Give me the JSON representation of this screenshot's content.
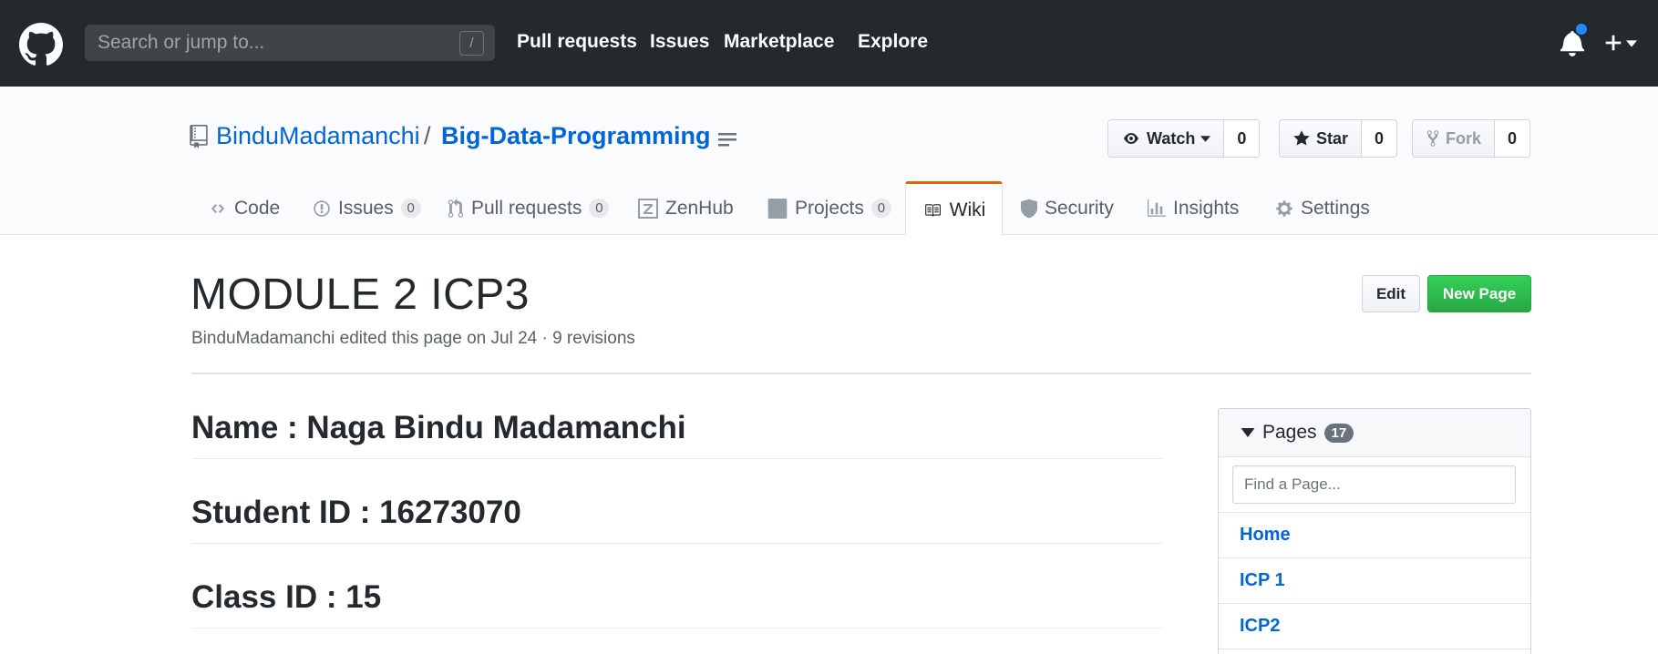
{
  "header": {
    "search_placeholder": "Search or jump to...",
    "search_shortcut": "/",
    "nav": [
      "Pull requests",
      "Issues",
      "Marketplace",
      "Explore"
    ]
  },
  "repo": {
    "owner": "BinduMadamanchi",
    "separator": "/",
    "name": "Big-Data-Programming",
    "watch": {
      "label": "Watch",
      "count": "0"
    },
    "star": {
      "label": "Star",
      "count": "0"
    },
    "fork": {
      "label": "Fork",
      "count": "0"
    }
  },
  "tabs": [
    {
      "label": "Code",
      "icon": "code-icon"
    },
    {
      "label": "Issues",
      "count": "0",
      "icon": "issue-icon"
    },
    {
      "label": "Pull requests",
      "count": "0",
      "icon": "pull-request-icon"
    },
    {
      "label": "ZenHub",
      "icon": "zenhub-icon"
    },
    {
      "label": "Projects",
      "count": "0",
      "icon": "project-icon"
    },
    {
      "label": "Wiki",
      "icon": "book-icon",
      "selected": true
    },
    {
      "label": "Security",
      "icon": "shield-icon"
    },
    {
      "label": "Insights",
      "icon": "graph-icon"
    },
    {
      "label": "Settings",
      "icon": "gear-icon"
    }
  ],
  "wiki": {
    "title": "MODULE 2 ICP3",
    "meta": "BinduMadamanchi edited this page on Jul 24 · 9 revisions",
    "edit_label": "Edit",
    "new_page_label": "New Page",
    "headings": [
      "Name : Naga Bindu Madamanchi",
      "Student ID : 16273070",
      "Class ID : 15"
    ]
  },
  "sidebar": {
    "pages_label": "Pages",
    "pages_count": "17",
    "filter_placeholder": "Find a Page...",
    "pages": [
      "Home",
      "ICP 1",
      "ICP2"
    ]
  },
  "colors": {
    "header_bg": "#24292e",
    "link": "#0366d6",
    "selected_tab_accent": "#e36209",
    "primary_button": "#28a745",
    "notification_dot": "#2188ff"
  }
}
